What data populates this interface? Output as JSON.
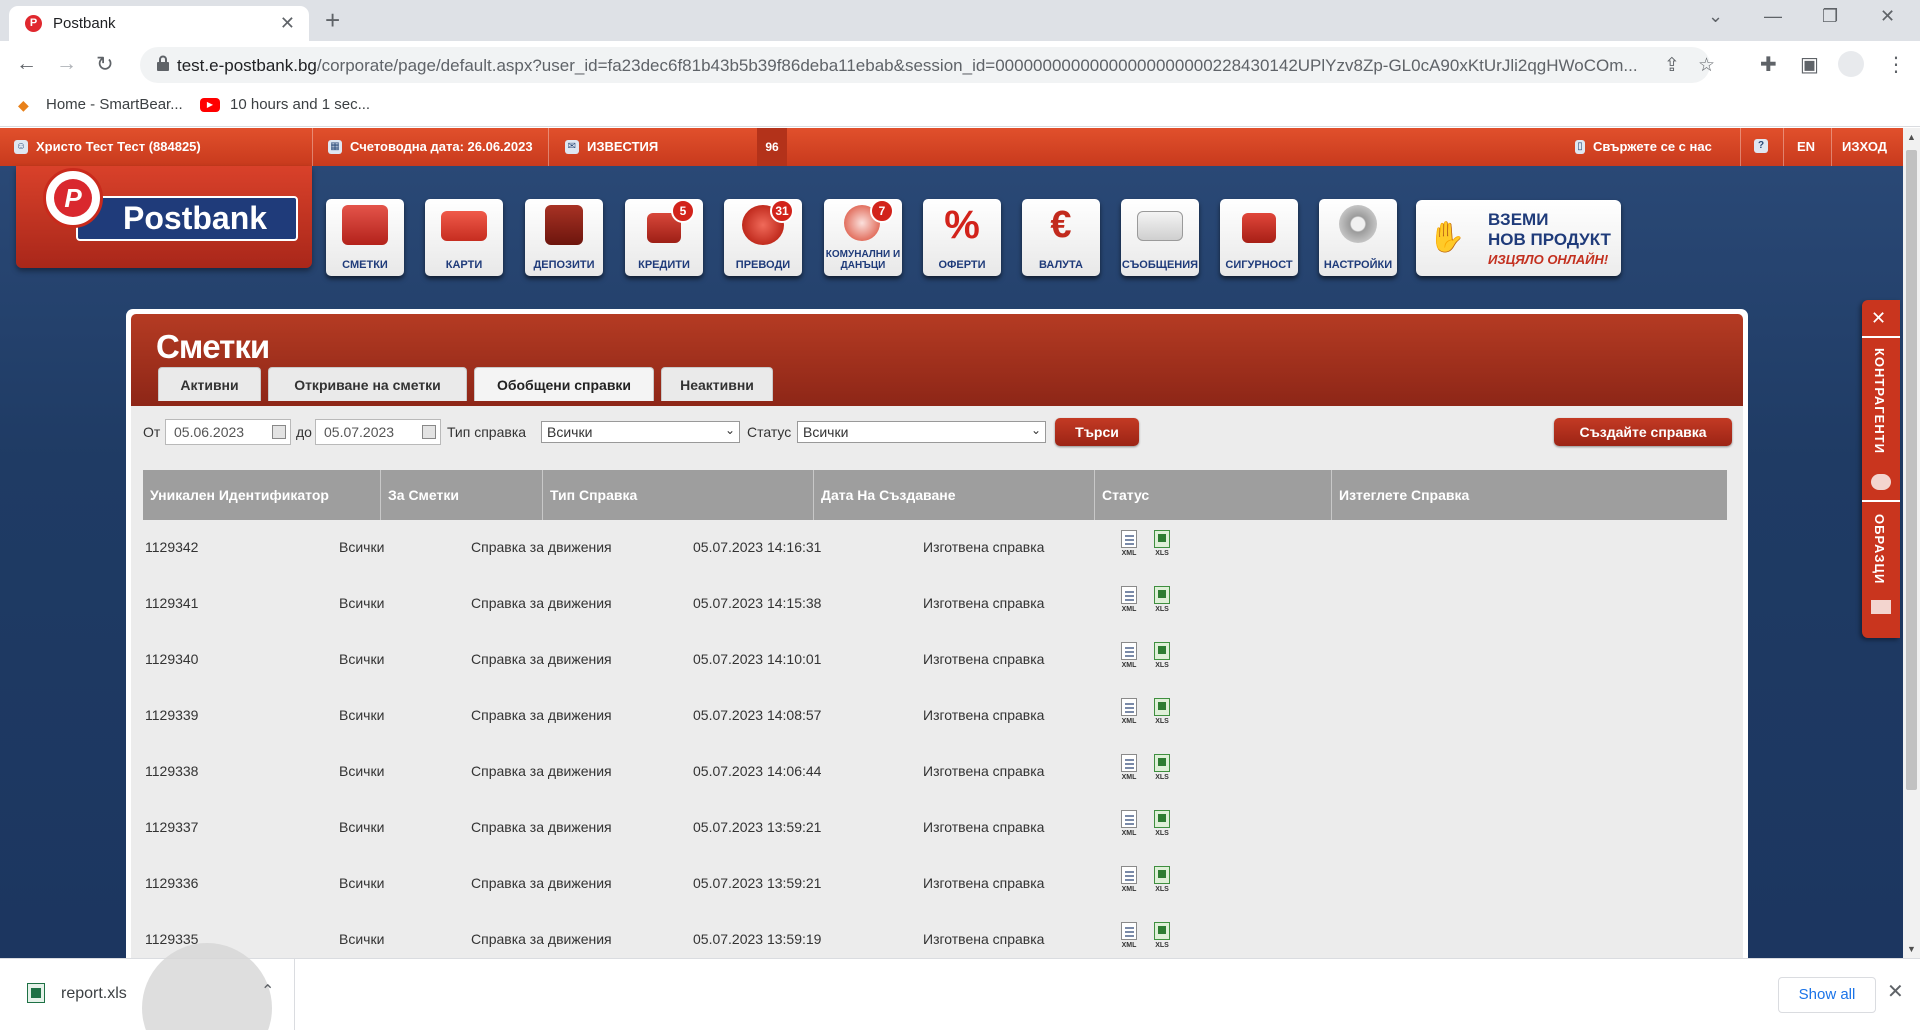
{
  "browser": {
    "tab_title": "Postbank",
    "tab_close": "✕",
    "new_tab": "+",
    "url_host": "test.e-postbank.bg",
    "url_path": "/corporate/page/default.aspx?user_id=fa23dec6f81b43b5b39f86deba11ebab&session_id=00000000000000000000000228430142UPlYzv8Zp-GL0cA90xKtUrJli2qgHWoCOm...",
    "bookmarks": [
      {
        "label": "Home - SmartBear..."
      },
      {
        "label": "10 hours and 1 sec..."
      }
    ]
  },
  "topbar": {
    "user": "Христо Тест Тест (884825)",
    "accounting_date": "Счетоводна дата: 26.06.2023",
    "news": "ИЗВЕСТИЯ",
    "news_count": "96",
    "contact": "Свържете се с нас",
    "help": "?",
    "language": "EN",
    "logout": "ИЗХОД"
  },
  "logo": {
    "text": "Postbank",
    "mark": "P"
  },
  "menu": [
    {
      "label": "СМЕТКИ",
      "icon": "accounts-icon",
      "badge": ""
    },
    {
      "label": "КАРТИ",
      "icon": "cards-icon",
      "badge": ""
    },
    {
      "label": "ДЕПОЗИТИ",
      "icon": "safe-icon",
      "badge": ""
    },
    {
      "label": "КРЕДИТИ",
      "icon": "house-icon",
      "badge": "5"
    },
    {
      "label": "ПРЕВОДИ",
      "icon": "transfer-icon",
      "badge": "31"
    },
    {
      "label": "КОМУНАЛНИ И ДАНЪЦИ",
      "icon": "utilities-icon",
      "badge": "7"
    },
    {
      "label": "ОФЕРТИ",
      "icon": "percent-icon",
      "badge": ""
    },
    {
      "label": "ВАЛУТА",
      "icon": "currency-icon",
      "badge": ""
    },
    {
      "label": "СЪОБЩЕНИЯ",
      "icon": "envelope-icon",
      "badge": ""
    },
    {
      "label": "СИГУРНОСТ",
      "icon": "lock-icon",
      "badge": ""
    },
    {
      "label": "НАСТРОЙКИ",
      "icon": "gear-icon",
      "badge": ""
    }
  ],
  "promo": {
    "line1": "ВЗЕМИ",
    "line2": "НОВ ПРОДУКТ",
    "line3": "ИЗЦЯЛО ОНЛАЙН!"
  },
  "side_panel": {
    "tab1": "КОНТРАГЕНТИ",
    "tab2": "ОБРАЗЦИ"
  },
  "panel": {
    "title": "Сметки",
    "tabs": [
      "Активни",
      "Откриване на сметки",
      "Обобщени справки",
      "Неактивни"
    ],
    "active_tab": "Обобщени справки"
  },
  "filters": {
    "from_label": "От",
    "from_value": "05.06.2023",
    "to_label": "до",
    "to_value": "05.07.2023",
    "type_label": "Тип справка",
    "type_value": "Всички",
    "status_label": "Статус",
    "status_value": "Всички",
    "search_button": "Търси",
    "create_button": "Създайте справка"
  },
  "table": {
    "columns": [
      "Уникален Идентификатор",
      "За Сметки",
      "Тип Справка",
      "Дата На Създаване",
      "Статус",
      "Изтеглете Справка"
    ],
    "rows": [
      {
        "id": "1129342",
        "accounts": "Всички",
        "type": "Справка за движения",
        "created": "05.07.2023 14:16:31",
        "status": "Изготвена справка"
      },
      {
        "id": "1129341",
        "accounts": "Всички",
        "type": "Справка за движения",
        "created": "05.07.2023 14:15:38",
        "status": "Изготвена справка"
      },
      {
        "id": "1129340",
        "accounts": "Всички",
        "type": "Справка за движения",
        "created": "05.07.2023 14:10:01",
        "status": "Изготвена справка"
      },
      {
        "id": "1129339",
        "accounts": "Всички",
        "type": "Справка за движения",
        "created": "05.07.2023 14:08:57",
        "status": "Изготвена справка"
      },
      {
        "id": "1129338",
        "accounts": "Всички",
        "type": "Справка за движения",
        "created": "05.07.2023 14:06:44",
        "status": "Изготвена справка"
      },
      {
        "id": "1129337",
        "accounts": "Всички",
        "type": "Справка за движения",
        "created": "05.07.2023 13:59:21",
        "status": "Изготвена справка"
      },
      {
        "id": "1129336",
        "accounts": "Всички",
        "type": "Справка за движения",
        "created": "05.07.2023 13:59:21",
        "status": "Изготвена справка"
      },
      {
        "id": "1129335",
        "accounts": "Всички",
        "type": "Справка за движения",
        "created": "05.07.2023 13:59:19",
        "status": "Изготвена справка"
      }
    ],
    "download_xml": "XML",
    "download_xls": "XLS"
  },
  "downloads": {
    "file": "report.xls",
    "show_all": "Show all"
  },
  "colors": {
    "brand_red": "#c83a1d",
    "brand_blue": "#1f3b7a",
    "page_bg": "#1f3b64"
  }
}
